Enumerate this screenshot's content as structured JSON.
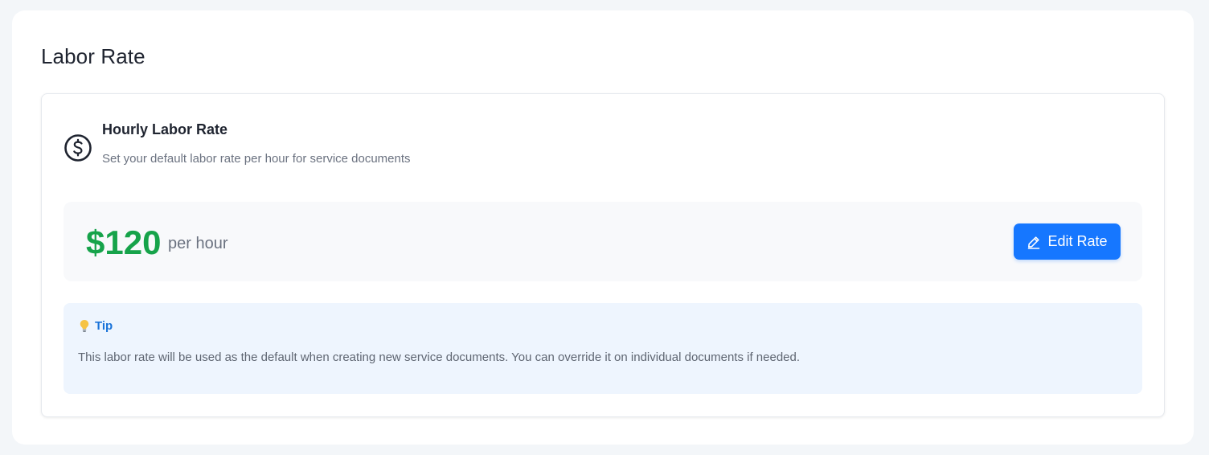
{
  "page": {
    "title": "Labor Rate"
  },
  "rate_section": {
    "title": "Hourly Labor Rate",
    "description": "Set your default labor rate per hour for service documents",
    "icon": "dollar-circle-icon"
  },
  "rate": {
    "value": "$120",
    "unit": "per hour",
    "edit_label": "Edit Rate",
    "edit_icon": "pencil-icon"
  },
  "tip": {
    "icon": "lightbulb-icon",
    "label": "Tip",
    "text": "This labor rate will be used as the default when creating new service documents. You can override it on individual documents if needed."
  },
  "colors": {
    "accent": "#1677ff",
    "rate_green": "#16a34a",
    "tip_blue": "#1a73d9",
    "tip_bg": "#eef5fe"
  }
}
